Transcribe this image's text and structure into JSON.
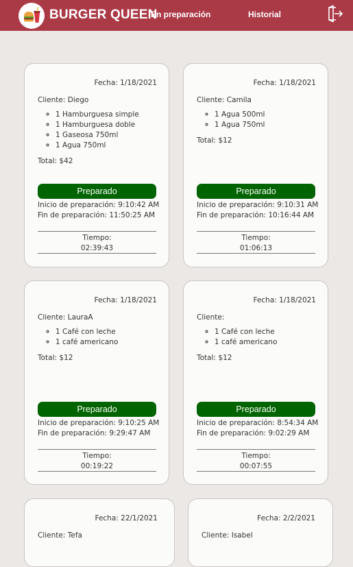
{
  "header": {
    "brand": "BURGER QUEEN",
    "nav_in_preparation": "En preparación",
    "nav_history": "Historial",
    "logo_icon": "burger-drink-logo",
    "logout_icon": "logout-icon",
    "bg_color": "#ab3a47"
  },
  "orders": [
    {
      "date": "Fecha: 1/18/2021",
      "client": "Cliente: Diego",
      "items": [
        "1 Hamburguesa simple",
        "1 Hamburguesa doble",
        "1 Gaseosa 750ml",
        "1 Agua 750ml"
      ],
      "total": "Total: $42",
      "button": "Preparado",
      "start": "Inicio de preparación: 9:10:42 AM",
      "end": "Fin de preparación: 11:50:25 AM",
      "time_label": "Tiempo:",
      "time_value": "02:39:43"
    },
    {
      "date": "Fecha: 1/18/2021",
      "client": "Cliente: Camila",
      "items": [
        "1 Agua 500ml",
        "1 Agua 750ml"
      ],
      "total": "Total: $12",
      "button": "Preparado",
      "start": "Inicio de preparación: 9:10:31 AM",
      "end": "Fin de preparación: 10:16:44 AM",
      "time_label": "Tiempo:",
      "time_value": "01:06:13"
    },
    {
      "date": "Fecha: 1/18/2021",
      "client": "Cliente: LauraA",
      "items": [
        "1 Café con leche",
        "1 café americano"
      ],
      "total": "Total: $12",
      "button": "Preparado",
      "start": "Inicio de preparación: 9:10:25 AM",
      "end": "Fin de preparación: 9:29:47 AM",
      "time_label": "Tiempo:",
      "time_value": "00:19:22"
    },
    {
      "date": "Fecha: 1/18/2021",
      "client": "Cliente:",
      "items": [
        "1 Café con leche",
        "1 café americano"
      ],
      "total": "Total: $12",
      "button": "Preparado",
      "start": "Inicio de preparación: 8:54:34 AM",
      "end": "Fin de preparación: 9:02:29 AM",
      "time_label": "Tiempo:",
      "time_value": "00:07:55"
    },
    {
      "date": "Fecha: 22/1/2021",
      "client": "Cliente: Tefa"
    },
    {
      "date": "Fecha: 2/2/2021",
      "client": "Cliente: Isabel"
    }
  ],
  "colors": {
    "button": "#006400",
    "page_bg": "#ece8e6"
  }
}
